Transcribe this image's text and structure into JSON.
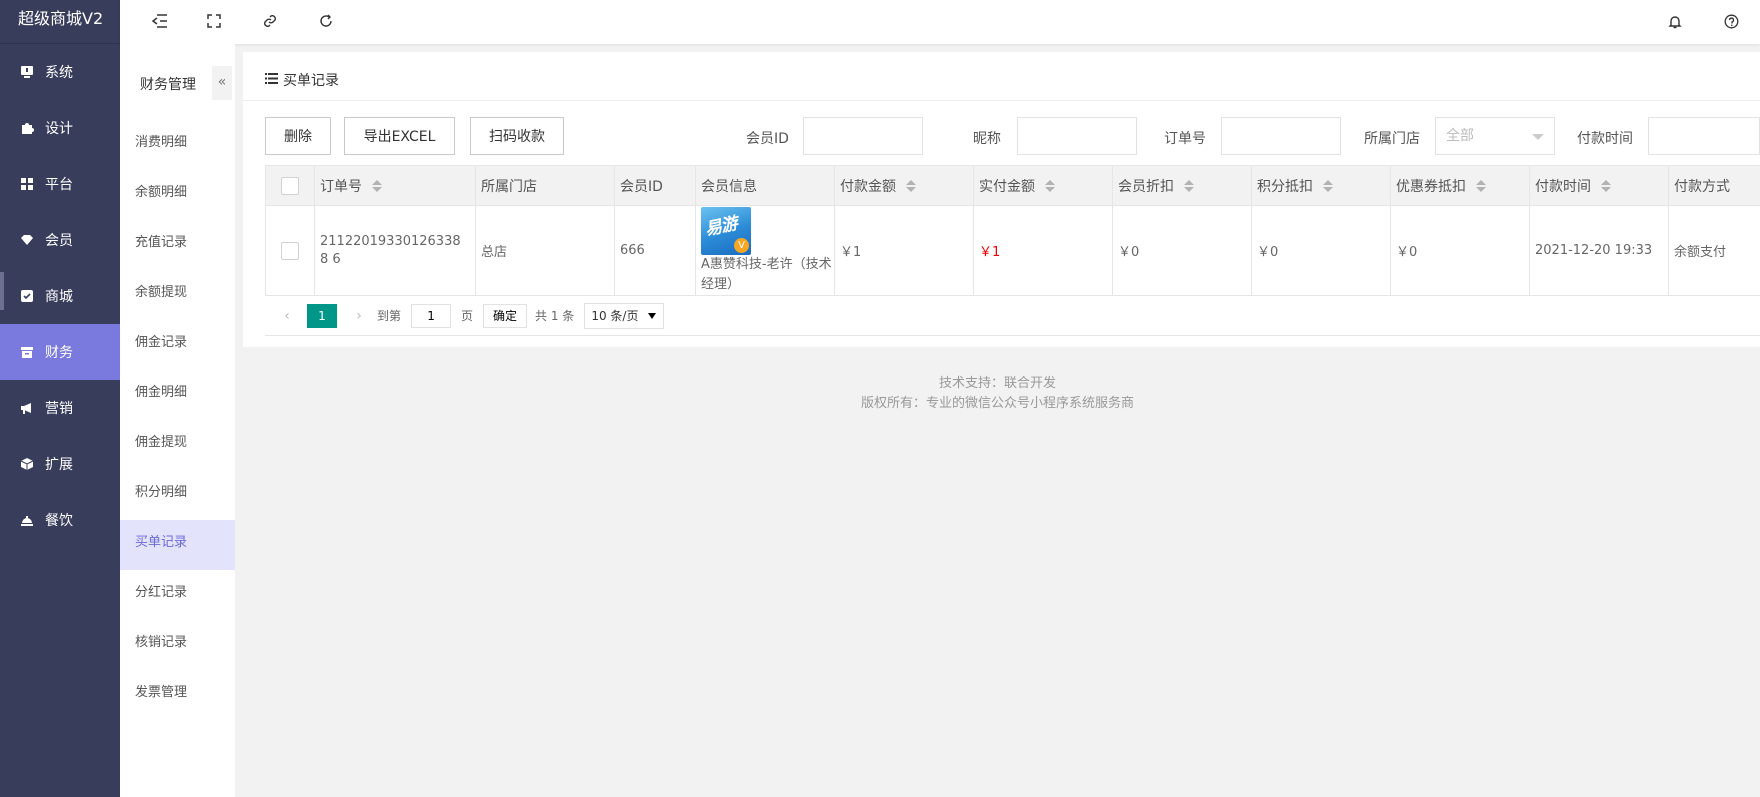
{
  "app": {
    "logo": "超级商城V2"
  },
  "sidebar": {
    "items": [
      {
        "label": "系统",
        "icon": "monitor-icon"
      },
      {
        "label": "设计",
        "icon": "puzzle-icon"
      },
      {
        "label": "平台",
        "icon": "grid-icon"
      },
      {
        "label": "会员",
        "icon": "diamond-icon"
      },
      {
        "label": "商城",
        "icon": "check-square-icon"
      },
      {
        "label": "财务",
        "icon": "archive-icon",
        "active": true
      },
      {
        "label": "营销",
        "icon": "megaphone-icon"
      },
      {
        "label": "扩展",
        "icon": "cube-icon"
      },
      {
        "label": "餐饮",
        "icon": "dish-icon"
      }
    ]
  },
  "topbar": {
    "icons": [
      "menu-fold-icon",
      "fullscreen-icon",
      "link-icon",
      "refresh-icon",
      "bell-icon",
      "help-icon"
    ]
  },
  "subnav": {
    "title": "财务管理",
    "collapse": "«",
    "items": [
      "消费明细",
      "余额明细",
      "充值记录",
      "余额提现",
      "佣金记录",
      "佣金明细",
      "佣金提现",
      "积分明细",
      "买单记录",
      "分红记录",
      "核销记录",
      "发票管理"
    ],
    "active_index": 8
  },
  "main": {
    "title": "买单记录",
    "buttons": {
      "delete": "删除",
      "export": "导出EXCEL",
      "scan": "扫码收款"
    },
    "filters": {
      "member_id": "会员ID",
      "nickname": "昵称",
      "order_no": "订单号",
      "store": "所属门店",
      "store_value": "全部",
      "pay_time": "付款时间"
    }
  },
  "table": {
    "headers": [
      "订单号",
      "所属门店",
      "会员ID",
      "会员信息",
      "付款金额",
      "实付金额",
      "会员折扣",
      "积分抵扣",
      "优惠券抵扣",
      "付款时间",
      "付款方式"
    ],
    "rows": [
      {
        "order_no": "211220193301263388 6",
        "store": "总店",
        "member_id": "666",
        "avatar_text": "易游",
        "avatar_badge": "V",
        "member_info": "A惠赞科技-老许（技术经理）",
        "pay_amount": "￥1",
        "actual_amount": "￥1",
        "member_discount": "￥0",
        "points_deduct": "￥0",
        "coupon_deduct": "￥0",
        "pay_time": "2021-12-20 19:33",
        "pay_method": "余额支付"
      }
    ]
  },
  "pager": {
    "prev": "‹",
    "next": "›",
    "current": "1",
    "goto_label": "到第",
    "goto_value": "1",
    "page_unit": "页",
    "confirm": "确定",
    "total": "共 1 条",
    "page_size": "10 条/页"
  },
  "footer": {
    "line1": "技术支持：联合开发",
    "line2": "版权所有：专业的微信公众号小程序系统服务商"
  },
  "colors": {
    "sidebar_bg": "#393d5c",
    "active": "#7a79dd",
    "pager_active": "#009688",
    "amount_red": "#f00000"
  }
}
